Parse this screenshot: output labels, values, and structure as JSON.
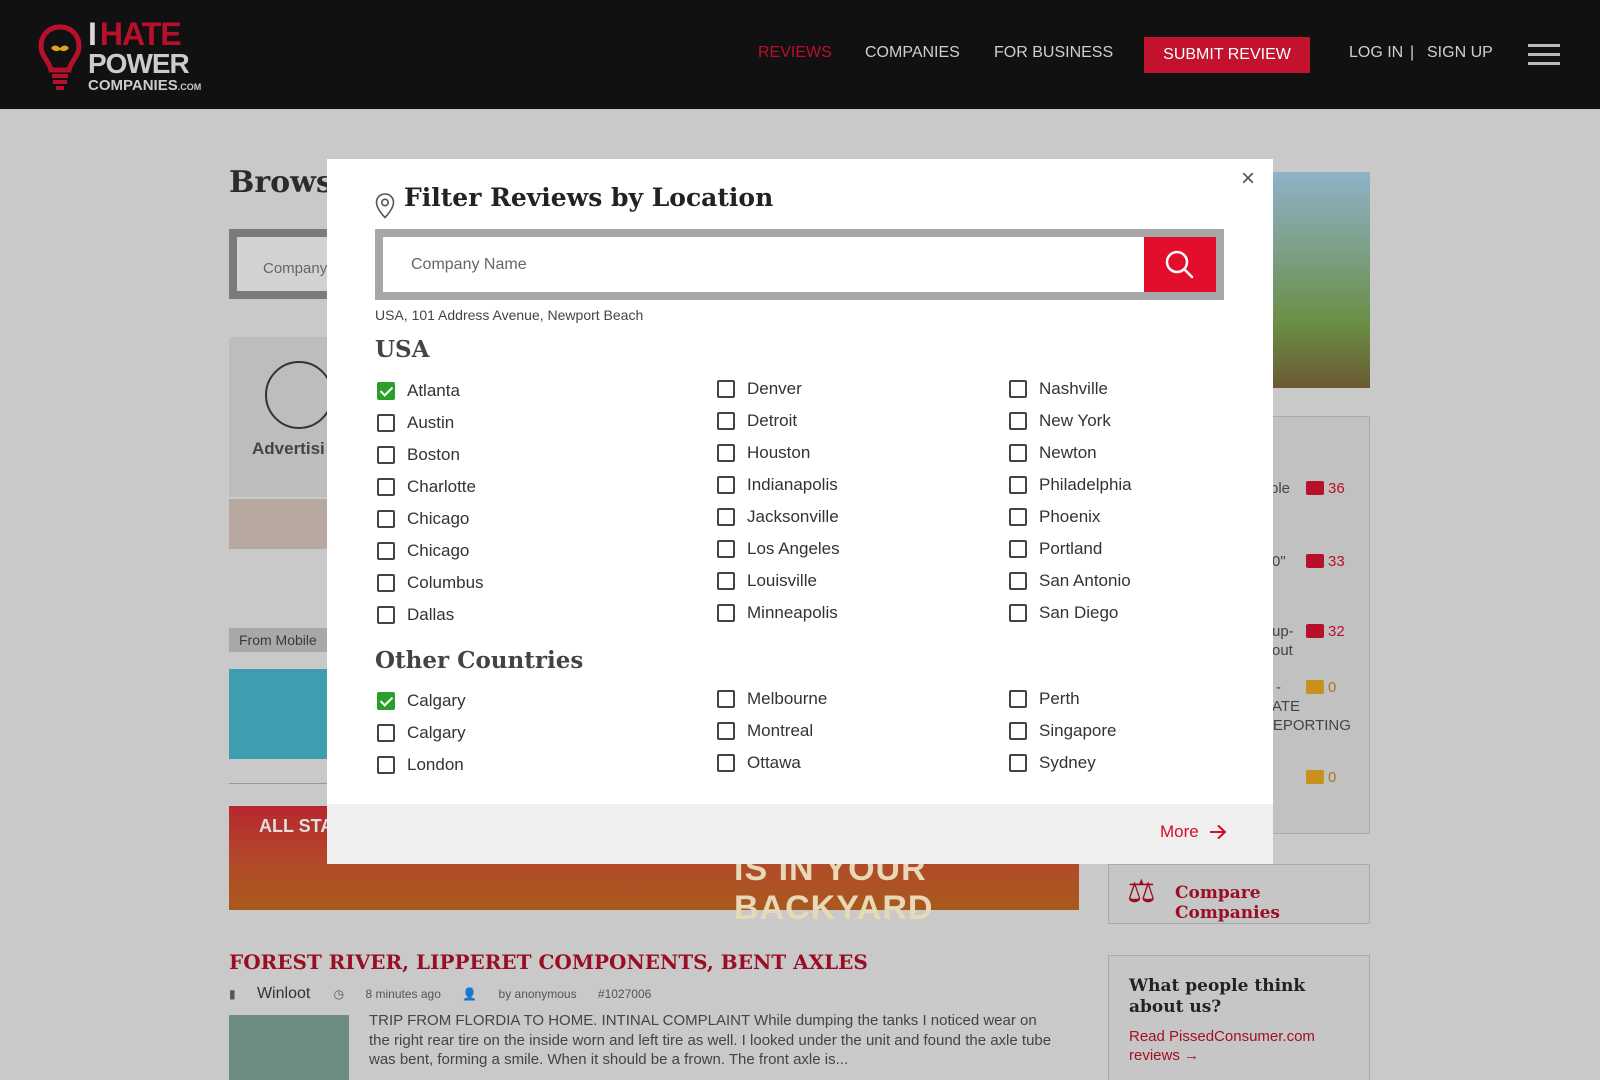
{
  "header": {
    "logo": {
      "line1_i": "I",
      "line1": "HATE",
      "line2": "POWER",
      "line3": "COMPANIES",
      "line3_suffix": ".COM"
    },
    "nav": [
      {
        "label": "REVIEWS",
        "active": true
      },
      {
        "label": "COMPANIES",
        "active": false
      },
      {
        "label": "FOR BUSINESS",
        "active": false
      }
    ],
    "submit_label": "SUBMIT REVIEW",
    "login_label": "LOG IN",
    "separator": "|",
    "signup_label": "SIGN UP"
  },
  "background": {
    "browse_title": "Browse",
    "search_placeholder": "Company",
    "advertising_label": "Advertisi",
    "from_mobile": "From Mobile",
    "banner_text": "IS IN YOUR BACKYARD",
    "banner_logo": "ALL STAR GAME",
    "side_items": [
      {
        "text": "ple",
        "count": "36",
        "gold": false
      },
      {
        "text": "0\"",
        "count": "33",
        "gold": false
      },
      {
        "text": "up-",
        "text2": "out",
        "count": "32",
        "gold": false
      },
      {
        "text": "-",
        "text2": "ATE",
        "text3": "REPORTING",
        "count": "0",
        "gold": true
      },
      {
        "text": "",
        "count": "0",
        "gold": true
      }
    ],
    "compare_label": "Compare Companies",
    "think_title": "What people think about us?",
    "think_link": "Read PissedConsumer.com reviews",
    "post": {
      "title": "FOREST RIVER, LIPPERET COMPONENTS, BENT AXLES",
      "company": "Winloot",
      "time": "8 minutes ago",
      "author": "by anonymous",
      "id": "#1027006",
      "body": "TRIP FROM FLORDIA TO HOME. INTINAL COMPLAINT While dumping the tanks I noticed wear on the right rear tire on the inside worn and left tire as well. I looked under the unit and found the axle tube was bent, forming a smile. When it should be a frown. The front axle is..."
    }
  },
  "modal": {
    "title": "Filter Reviews by Location",
    "close_label": "×",
    "search": {
      "placeholder": "Company Name",
      "value": ""
    },
    "address": "USA, 101 Address Avenue, Newport Beach",
    "usa": {
      "heading": "USA",
      "columns": [
        [
          {
            "label": "Atlanta",
            "checked": true
          },
          {
            "label": "Austin",
            "checked": false
          },
          {
            "label": "Boston",
            "checked": false
          },
          {
            "label": "Charlotte",
            "checked": false
          },
          {
            "label": "Chicago",
            "checked": false
          },
          {
            "label": "Chicago",
            "checked": false
          },
          {
            "label": "Columbus",
            "checked": false
          },
          {
            "label": "Dallas",
            "checked": false
          }
        ],
        [
          {
            "label": "Denver",
            "checked": false
          },
          {
            "label": "Detroit",
            "checked": false
          },
          {
            "label": "Houston",
            "checked": false
          },
          {
            "label": "Indianapolis",
            "checked": false
          },
          {
            "label": "Jacksonville",
            "checked": false
          },
          {
            "label": "Los Angeles",
            "checked": false
          },
          {
            "label": "Louisville",
            "checked": false
          },
          {
            "label": "Minneapolis",
            "checked": false
          }
        ],
        [
          {
            "label": "Nashville",
            "checked": false
          },
          {
            "label": "New York",
            "checked": false
          },
          {
            "label": "Newton",
            "checked": false
          },
          {
            "label": "Philadelphia",
            "checked": false
          },
          {
            "label": "Phoenix",
            "checked": false
          },
          {
            "label": "Portland",
            "checked": false
          },
          {
            "label": "San Antonio",
            "checked": false
          },
          {
            "label": "San Diego",
            "checked": false
          }
        ]
      ]
    },
    "other": {
      "heading": "Other Countries",
      "columns": [
        [
          {
            "label": "Calgary",
            "checked": true
          },
          {
            "label": "Calgary",
            "checked": false
          },
          {
            "label": "London",
            "checked": false
          }
        ],
        [
          {
            "label": "Melbourne",
            "checked": false
          },
          {
            "label": "Montreal",
            "checked": false
          },
          {
            "label": "Ottawa",
            "checked": false
          }
        ],
        [
          {
            "label": "Perth",
            "checked": false
          },
          {
            "label": "Singapore",
            "checked": false
          },
          {
            "label": "Sydney",
            "checked": false
          }
        ]
      ]
    },
    "more_label": "More"
  },
  "colors": {
    "accent": "#e30d2c",
    "brand_red": "#b8102b",
    "check_green": "#2aa02a"
  }
}
